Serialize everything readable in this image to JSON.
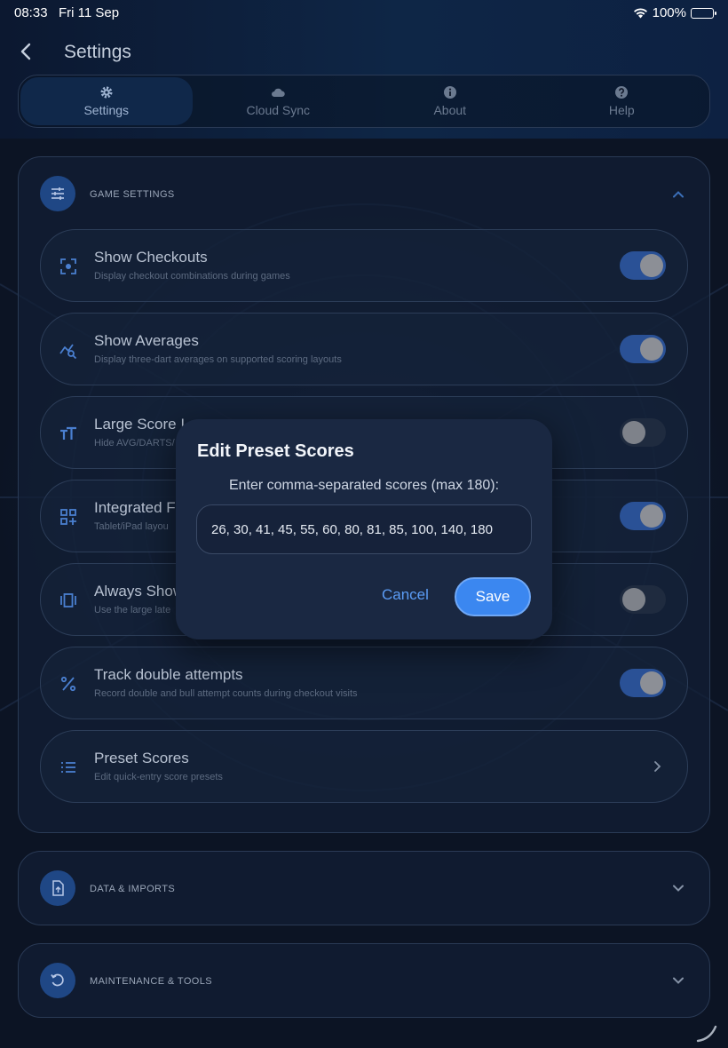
{
  "status": {
    "time": "08:33",
    "date": "Fri 11 Sep",
    "battery": "100%"
  },
  "header": {
    "title": "Settings"
  },
  "tabs": [
    {
      "label": "Settings",
      "icon": "gear-icon",
      "active": true
    },
    {
      "label": "Cloud Sync",
      "icon": "cloud-icon",
      "active": false
    },
    {
      "label": "About",
      "icon": "info-icon",
      "active": false
    },
    {
      "label": "Help",
      "icon": "help-icon",
      "active": false
    }
  ],
  "game_settings": {
    "title": "GAME SETTINGS",
    "icon": "sliders-icon",
    "expanded": true,
    "rows": [
      {
        "label": "Show Checkouts",
        "desc": "Display checkout combinations during games",
        "icon": "target-icon",
        "toggle": true
      },
      {
        "label": "Show Averages",
        "desc": "Display three-dart averages on supported scoring layouts",
        "icon": "chart-search-icon",
        "toggle": true
      },
      {
        "label": "Large Score I",
        "desc": "Hide AVG/DARTS/",
        "icon": "text-size-icon",
        "toggle": false
      },
      {
        "label": "Integrated F",
        "desc": "Tablet/iPad layou",
        "icon": "grid-add-icon",
        "toggle": true
      },
      {
        "label": "Always Show",
        "desc": "Use the large late",
        "icon": "carousel-icon",
        "toggle": false
      },
      {
        "label": "Track double attempts",
        "desc": "Record double and bull attempt counts during checkout visits",
        "icon": "percent-icon",
        "toggle": true
      },
      {
        "label": "Preset Scores",
        "desc": "Edit quick-entry score presets",
        "icon": "list-icon",
        "toggle": null
      }
    ]
  },
  "data_imports": {
    "title": "DATA & IMPORTS",
    "icon": "file-upload-icon"
  },
  "maintenance": {
    "title": "MAINTENANCE & TOOLS",
    "icon": "restore-icon"
  },
  "dialog": {
    "title": "Edit Preset Scores",
    "message": "Enter comma-separated scores (max 180):",
    "value": "26, 30, 41, 45, 55, 60, 80, 81, 85, 100, 140, 180",
    "cancel_label": "Cancel",
    "save_label": "Save"
  },
  "colors": {
    "accent": "#3b87f0",
    "toggle_on": "#2a5196",
    "section_icon_bg": "#1f4785"
  }
}
